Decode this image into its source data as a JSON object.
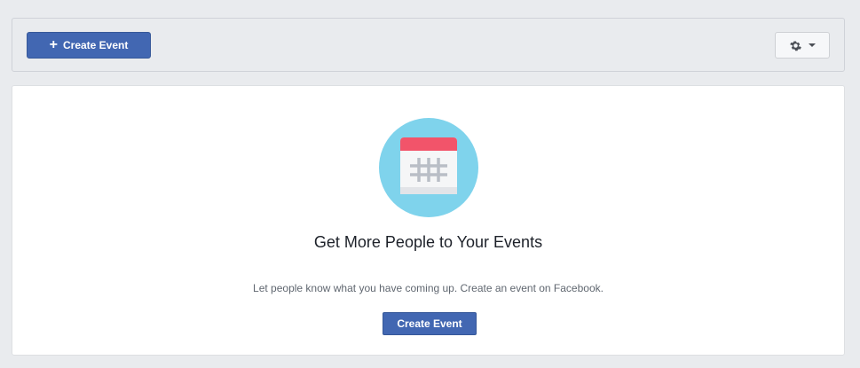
{
  "toolbar": {
    "create_event_label": "Create Event",
    "plus_symbol": "+",
    "settings_icon": "gear-icon",
    "settings_caret_icon": "caret-down-icon"
  },
  "empty_state": {
    "illustration_icon": "calendar-icon",
    "headline": "Get More People to Your Events",
    "description": "Let people know what you have coming up. Create an event on Facebook.",
    "button_label": "Create Event"
  },
  "colors": {
    "primary_button": "#4267b2",
    "background": "#e9ebee",
    "illustration_circle": "#7fd3ec",
    "calendar_header": "#f2546a"
  }
}
